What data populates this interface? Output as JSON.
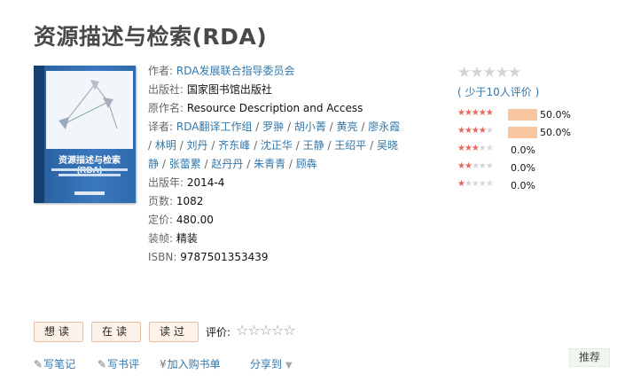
{
  "title": "资源描述与检索(RDA)",
  "cover": {
    "title_text": "资源描述与检索(RDA)"
  },
  "info": {
    "author_label": "作者:",
    "author": "RDA发展联合指导委员会",
    "publisher_label": "出版社:",
    "publisher": "国家图书馆出版社",
    "original_title_label": "原作名:",
    "original_title": "Resource Description and Access",
    "translator_label": "译者:",
    "translators": [
      "RDA翻译工作组",
      "罗翀",
      "胡小菁",
      "黄亮",
      "廖永霞",
      "林明",
      "刘丹",
      "齐东峰",
      "沈正华",
      "王静",
      "王绍平",
      "吴晓静",
      "张蕾累",
      "赵丹丹",
      "朱青青",
      "顾犇"
    ],
    "pubdate_label": "出版年:",
    "pubdate": "2014-4",
    "pages_label": "页数:",
    "pages": "1082",
    "price_label": "定价:",
    "price": "480.00",
    "binding_label": "装帧:",
    "binding": "精装",
    "isbn_label": "ISBN:",
    "isbn": "9787501353439"
  },
  "rating": {
    "overall_stars": 0,
    "few_ratings_text": "( 少于10人评价 )",
    "breakdown": [
      {
        "stars": 5,
        "percent": 50.0,
        "label": "50.0%"
      },
      {
        "stars": 4,
        "percent": 50.0,
        "label": "50.0%"
      },
      {
        "stars": 3,
        "percent": 0.0,
        "label": "0.0%"
      },
      {
        "stars": 2,
        "percent": 0.0,
        "label": "0.0%"
      },
      {
        "stars": 1,
        "percent": 0.0,
        "label": "0.0%"
      }
    ]
  },
  "buttons": {
    "want": "想读",
    "reading": "在读",
    "read": "读过"
  },
  "rate_label": "评价:",
  "actions": {
    "note": "写笔记",
    "review": "写书评",
    "cart": "加入购书单",
    "share": "分享到"
  },
  "recommend": "推荐",
  "colors": {
    "link": "#3377aa",
    "star_on": "#e8665c",
    "bar": "#f7c5a0",
    "button_bg": "#fff2e8"
  }
}
